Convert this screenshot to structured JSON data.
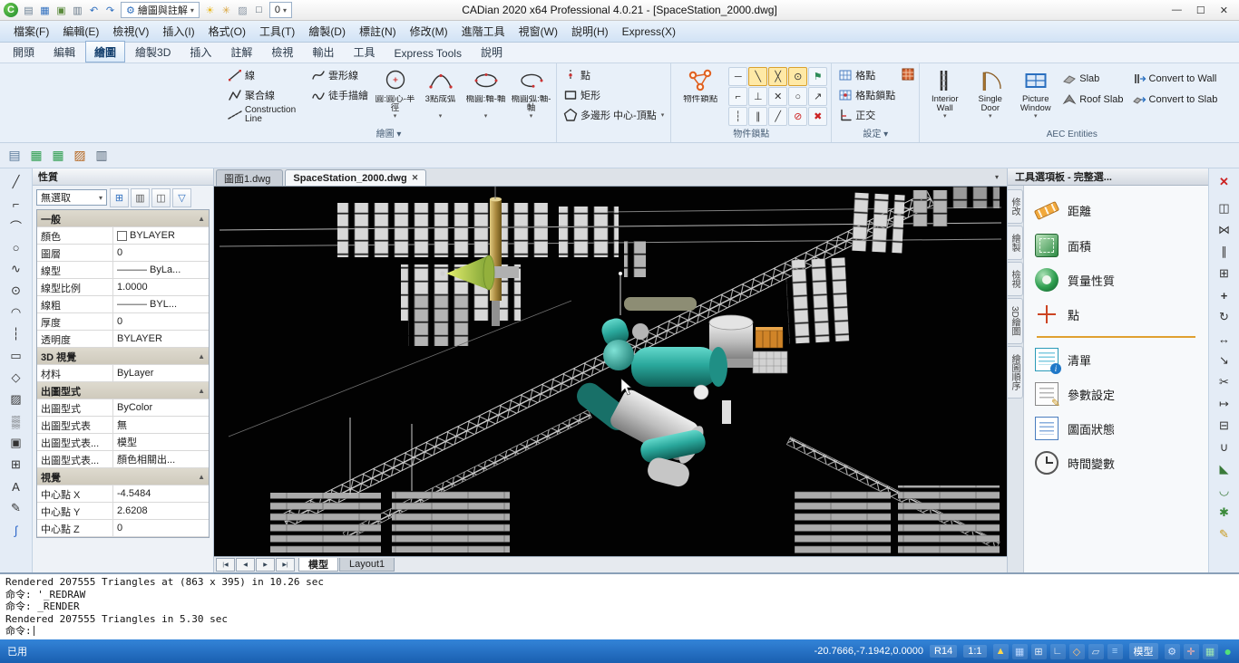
{
  "glyphs": {
    "dd": "▾",
    "min": "—",
    "max": "☐",
    "close": "✕",
    "gear": "⚙",
    "indicator": "●",
    "logo": "C"
  },
  "titlebar": {
    "title": "CADian 2020 x64 Professional 4.0.21 - [SpaceStation_2000.dwg]",
    "workspace_combo": "繪圖與註解",
    "layer_combo": "0",
    "icons": [
      {
        "glyph": "▤",
        "name": "new-drawing-icon",
        "style": "color:#6a7f94"
      },
      {
        "glyph": "▦",
        "name": "open-drawing-icon",
        "style": "color:#2f6fbf"
      },
      {
        "glyph": "▣",
        "name": "save-icon",
        "style": "color:#5a8a3c"
      },
      {
        "glyph": "▥",
        "name": "plot-icon",
        "style": "color:#667788"
      },
      {
        "glyph": "↶",
        "name": "undo-icon",
        "style": "color:#2f6fbf"
      },
      {
        "glyph": "↷",
        "name": "redo-icon",
        "style": "color:#2f6fbf"
      }
    ],
    "extra_icons": [
      {
        "glyph": "☀",
        "name": "brightness-icon",
        "style": "color:#e8b820"
      },
      {
        "glyph": "✳",
        "name": "effects-icon",
        "style": "color:#d9a43c"
      },
      {
        "glyph": "▨",
        "name": "transparency-icon",
        "style": "color:#8a96a4"
      },
      {
        "glyph": "□",
        "name": "color-swatch-icon",
        "style": "color:#445566"
      }
    ]
  },
  "menu": {
    "items": [
      "檔案(F)",
      "編輯(E)",
      "檢視(V)",
      "插入(I)",
      "格式(O)",
      "工具(T)",
      "繪製(D)",
      "標註(N)",
      "修改(M)",
      "進階工具",
      "視窗(W)",
      "說明(H)",
      "Express(X)"
    ]
  },
  "ribbon": {
    "tabs": [
      {
        "label": "開頭"
      },
      {
        "label": "編輯"
      },
      {
        "label": "繪圖",
        "active": true
      },
      {
        "label": "繪製3D"
      },
      {
        "label": "插入"
      },
      {
        "label": "註解"
      },
      {
        "label": "檢視"
      },
      {
        "label": "輸出"
      },
      {
        "label": "工具"
      },
      {
        "label": "Express Tools"
      },
      {
        "label": "說明"
      }
    ],
    "draw": {
      "label": "繪圖 ▾",
      "line": "線",
      "polyline": "聚合線",
      "construction": "Construction Line",
      "spline": "雲形線",
      "sketch": "徒手描繪",
      "circle": "圓:圓心-半徑",
      "arc": "3點成弧",
      "ellipse": "橢圓:軸-軸",
      "ellipse_arc": "橢圓弧:軸-軸"
    },
    "draw2": {
      "label": "",
      "point": "點",
      "rect": "矩形",
      "polygon": "多邊形 中心-頂點"
    },
    "osnap": {
      "label": "物件鎖點",
      "button": "物件鎖點",
      "snaps": [
        {
          "glyph": "─",
          "name": "snap-endpoint-icon"
        },
        {
          "glyph": "╲",
          "name": "snap-midpoint-icon",
          "sel": true
        },
        {
          "glyph": "╳",
          "name": "snap-intersection-icon",
          "sel": true
        },
        {
          "glyph": "⊙",
          "name": "snap-center-icon",
          "sel": true
        },
        {
          "glyph": "⚑",
          "name": "snap-marker-icon",
          "style": "color:#2e8b57"
        },
        {
          "glyph": "⌐",
          "name": "snap-extension-icon"
        },
        {
          "glyph": "⊥",
          "name": "snap-perpendicular-icon"
        },
        {
          "glyph": "✕",
          "name": "snap-apparent-icon"
        },
        {
          "glyph": "○",
          "name": "snap-quadrant-icon"
        },
        {
          "glyph": "↗",
          "name": "snap-tangent-icon"
        },
        {
          "glyph": "┆",
          "name": "snap-node-icon"
        },
        {
          "glyph": "∥",
          "name": "snap-parallel-icon"
        },
        {
          "glyph": "╱",
          "name": "snap-nearest-icon"
        },
        {
          "glyph": "⊘",
          "name": "snap-suppress-icon",
          "style": "color:#cc2222"
        },
        {
          "glyph": "✖",
          "name": "snap-none-icon",
          "style": "color:#cc2222"
        }
      ]
    },
    "settings": {
      "label": "設定 ▾",
      "grid": "格點",
      "grid_snap": "格點鎖點",
      "ortho": "正交"
    },
    "aec": {
      "label": "AEC Entities",
      "interior_wall": "Interior Wall",
      "single_door": "Single Door",
      "picture_window": "Picture Window",
      "slab": "Slab",
      "roof_slab": "Roof Slab",
      "convert_wall": "Convert to Wall",
      "convert_slab": "Convert to Slab"
    }
  },
  "std_toolbar": [
    {
      "glyph": "▤",
      "name": "layout-preview-icon",
      "style": "color:#5a7a9a"
    },
    {
      "glyph": "▦",
      "name": "sheet-set-icon",
      "style": "color:#2e9e4f"
    },
    {
      "glyph": "▦",
      "name": "table-export-icon",
      "style": "color:#2e9e4f"
    },
    {
      "glyph": "▨",
      "name": "render-presets-icon",
      "style": "color:#b5651d"
    },
    {
      "glyph": "▥",
      "name": "page-setup-icon",
      "style": "color:#556677"
    }
  ],
  "left_toolbar": [
    {
      "glyph": "╱",
      "name": "line-tool"
    },
    {
      "glyph": "⌐",
      "name": "polyline-tool"
    },
    {
      "glyph": "⌒",
      "name": "arc-tool"
    },
    {
      "glyph": "○",
      "name": "circle-tool"
    },
    {
      "glyph": "∿",
      "name": "spline-tool"
    },
    {
      "glyph": "⊙",
      "name": "ellipse-tool"
    },
    {
      "glyph": "◠",
      "name": "ellipse-arc-tool"
    },
    {
      "glyph": "┆",
      "name": "point-tool"
    },
    {
      "glyph": "▭",
      "name": "rectangle-tool"
    },
    {
      "glyph": "◇",
      "name": "polygon-tool"
    },
    {
      "glyph": "▨",
      "name": "hatch-tool"
    },
    {
      "glyph": "▒",
      "name": "gradient-tool"
    },
    {
      "glyph": "▣",
      "name": "region-tool"
    },
    {
      "glyph": "⊞",
      "name": "table-tool"
    },
    {
      "glyph": "A",
      "name": "text-tool"
    },
    {
      "glyph": "✎",
      "name": "freehand-tool"
    },
    {
      "glyph": "∫",
      "name": "spline-edit-tool",
      "style": "color:#2c66c9"
    }
  ],
  "right_toolbar": [
    {
      "glyph": "✕",
      "name": "erase-tool",
      "style": "color:#cc2222;margin-bottom:5px;font-weight:bold"
    },
    {
      "glyph": "◫",
      "name": "copy-tool"
    },
    {
      "glyph": "⋈",
      "name": "mirror-tool"
    },
    {
      "glyph": "∥",
      "name": "offset-tool"
    },
    {
      "glyph": "⊞",
      "name": "array-tool"
    },
    {
      "glyph": "+",
      "name": "move-tool",
      "style": "font-weight:bold"
    },
    {
      "glyph": "↻",
      "name": "rotate-tool"
    },
    {
      "glyph": "↔",
      "name": "scale-tool"
    },
    {
      "glyph": "↘",
      "name": "stretch-tool"
    },
    {
      "glyph": "✂",
      "name": "trim-tool"
    },
    {
      "glyph": "↦",
      "name": "extend-tool"
    },
    {
      "glyph": "⊟",
      "name": "break-tool"
    },
    {
      "glyph": "∪",
      "name": "join-tool"
    },
    {
      "glyph": "◣",
      "name": "chamfer-tool",
      "style": "color:#3a7a3a"
    },
    {
      "glyph": "◡",
      "name": "fillet-tool",
      "style": "color:#3a7a3a"
    },
    {
      "glyph": "✱",
      "name": "explode-tool",
      "style": "color:#3a8a3a"
    },
    {
      "glyph": "✎",
      "name": "edit-polyline-tool",
      "style": "color:#c89a1e"
    }
  ],
  "properties": {
    "title": "性質",
    "selector": "無選取",
    "toolbar_icons": [
      {
        "glyph": "⊞",
        "name": "quick-select-icon",
        "style": "color:#2f6fbf"
      },
      {
        "glyph": "▥",
        "name": "select-objects-icon",
        "style": "color:#555555"
      },
      {
        "glyph": "◫",
        "name": "pickadd-toggle-icon",
        "style": "color:#555555"
      },
      {
        "glyph": "▽",
        "name": "filter-icon",
        "style": "color:#2f6fbf"
      }
    ],
    "rows": [
      {
        "section": true,
        "label": "一般",
        "arrow": "▲"
      },
      {
        "label": "顏色",
        "value": "BYLAYER",
        "swatch": true
      },
      {
        "label": "圖層",
        "value": "0"
      },
      {
        "label": "線型",
        "value": "——— ByLa..."
      },
      {
        "label": "線型比例",
        "value": "1.0000"
      },
      {
        "label": "線粗",
        "value": "——— BYL..."
      },
      {
        "label": "厚度",
        "value": "0"
      },
      {
        "label": "透明度",
        "value": "BYLAYER"
      },
      {
        "section": true,
        "label": "3D 視覺",
        "arrow": "▲"
      },
      {
        "label": "材料",
        "value": "ByLayer"
      },
      {
        "section": true,
        "label": "出圖型式",
        "arrow": "▲"
      },
      {
        "label": "出圖型式",
        "value": "ByColor"
      },
      {
        "label": "出圖型式表",
        "value": "無"
      },
      {
        "label": "出圖型式表...",
        "value": "模型"
      },
      {
        "label": "出圖型式表...",
        "value": "顏色相關出..."
      },
      {
        "section": true,
        "label": "視覺",
        "arrow": "▲"
      },
      {
        "label": "中心點 X",
        "value": "-4.5484"
      },
      {
        "label": "中心點 Y",
        "value": "2.6208"
      },
      {
        "label": "中心點 Z",
        "value": "0"
      }
    ]
  },
  "drawing": {
    "tabs": [
      {
        "label": "圖面1.dwg"
      },
      {
        "label": "SpaceStation_2000.dwg",
        "active": true,
        "close": "✕"
      }
    ],
    "nav": [
      {
        "glyph": "|◀",
        "name": "first-layout-button"
      },
      {
        "glyph": "◀",
        "name": "previous-layout-button"
      },
      {
        "glyph": "▶",
        "name": "next-layout-button"
      },
      {
        "glyph": "▶|",
        "name": "last-layout-button"
      }
    ],
    "layout_tabs": [
      {
        "label": "模型",
        "active": true
      },
      {
        "label": "Layout1"
      }
    ]
  },
  "palette": {
    "title": "工具選項板 - 完整選...",
    "tabs": [
      "修改",
      "繪製",
      "檢視",
      "3D繪圖",
      "繪圖順序"
    ],
    "items": [
      {
        "label": "距離",
        "icon": "ruler"
      },
      {
        "label": "面積",
        "icon": "area"
      },
      {
        "label": "質量性質",
        "icon": "mass"
      },
      {
        "label": "點",
        "icon": "point"
      },
      {
        "separator": true
      },
      {
        "label": "清單",
        "icon": "list"
      },
      {
        "label": "參數設定",
        "icon": "settings"
      },
      {
        "label": "圖面狀態",
        "icon": "status"
      },
      {
        "label": "時間變數",
        "icon": "clock"
      }
    ]
  },
  "command": {
    "lines": [
      "Rendered 207555 Triangles at (863 x 395) in 10.26 sec",
      "命令: '_REDRAW",
      "命令: _RENDER",
      "Rendered 207555 Triangles in 5.30 sec"
    ],
    "prompt": "命令:"
  },
  "status": {
    "mode_label": "已用",
    "coords": "-20.7666,-7.1942,0.0000",
    "version": "R14",
    "scale": "1:1",
    "model": "模型",
    "toggles": [
      {
        "glyph": "▲",
        "name": "isoplane-toggle",
        "style": "color:#ffd84d"
      },
      {
        "glyph": "▦",
        "name": "grid-toggle",
        "style": "color:#bcd8ff"
      },
      {
        "glyph": "⊞",
        "name": "snap-toggle",
        "style": "color:#e8eef6"
      },
      {
        "glyph": "∟",
        "name": "ortho-toggle",
        "style": "color:#e8eef6"
      },
      {
        "glyph": "◇",
        "name": "polar-toggle",
        "style": "color:#ffc27a"
      },
      {
        "glyph": "▱",
        "name": "osnap-toggle",
        "style": "color:#d8e4f2"
      },
      {
        "glyph": "≡",
        "name": "lineweight-toggle",
        "style": "color:#9fd0ff"
      }
    ],
    "right_icons": [
      {
        "glyph": "⚙",
        "name": "settings-gear-icon",
        "style": "color:#cfe2ff"
      },
      {
        "glyph": "✛",
        "name": "crosshair-icon",
        "style": "color:#ffb3a8"
      },
      {
        "glyph": "▦",
        "name": "quick-view-icon",
        "style": "color:#9fe8b4"
      }
    ]
  }
}
